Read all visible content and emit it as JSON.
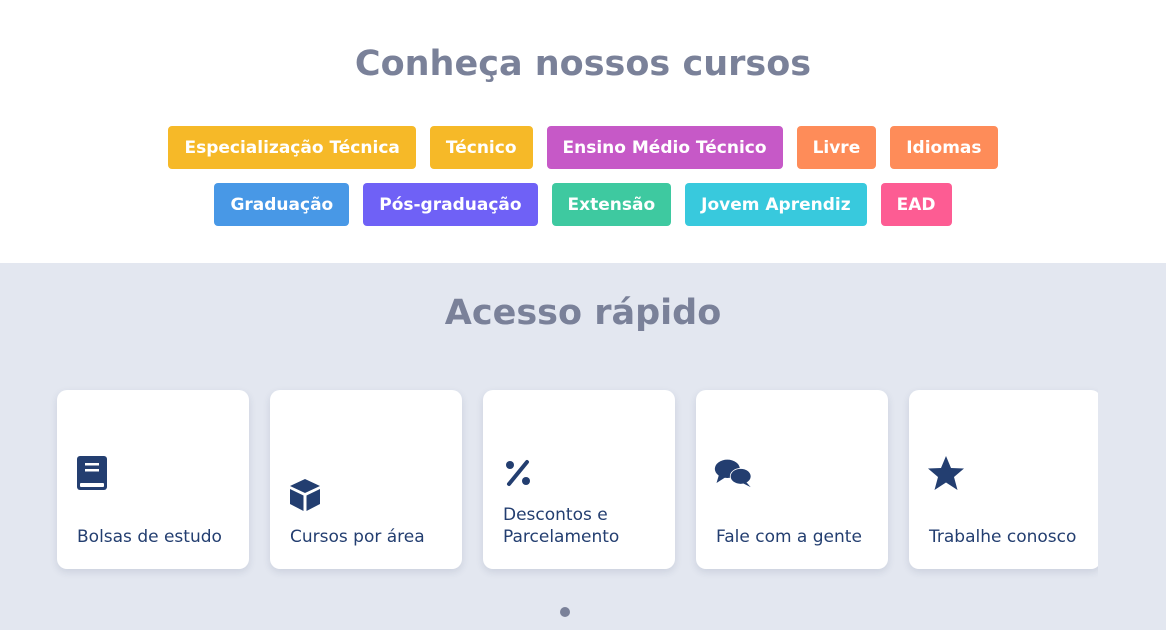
{
  "courses": {
    "title": "Conheça nossos cursos",
    "row1": [
      {
        "label": "Especialização Técnica",
        "color": "#f6b928"
      },
      {
        "label": "Técnico",
        "color": "#f6b928"
      },
      {
        "label": "Ensino Médio Técnico",
        "color": "#c659c7"
      },
      {
        "label": "Livre",
        "color": "#fe8c59"
      },
      {
        "label": "Idiomas",
        "color": "#fe8c59"
      }
    ],
    "row2": [
      {
        "label": "Graduação",
        "color": "#4898e6"
      },
      {
        "label": "Pós-graduação",
        "color": "#6f61f6"
      },
      {
        "label": "Extensão",
        "color": "#3ec9a0"
      },
      {
        "label": "Jovem Aprendiz",
        "color": "#38c9dd"
      },
      {
        "label": "EAD",
        "color": "#fd5c93"
      }
    ]
  },
  "quick_access": {
    "title": "Acesso rápido",
    "icon_color": "#233e70",
    "cards": [
      {
        "label": "Bolsas de estudo",
        "icon": "book-icon"
      },
      {
        "label": "Cursos por área",
        "icon": "cube-icon"
      },
      {
        "label": "Descontos e Parcelamento",
        "icon": "percent-icon"
      },
      {
        "label": "Fale com a gente",
        "icon": "chat-bubbles-icon"
      },
      {
        "label": "Trabalhe conosco",
        "icon": "star-icon"
      }
    ]
  }
}
